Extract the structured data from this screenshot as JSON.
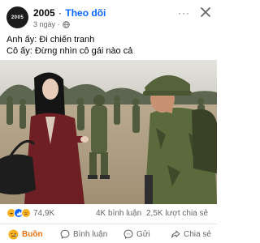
{
  "post": {
    "page_name": "2005",
    "separator": "·",
    "follow_label": "Theo dõi",
    "time_ago": "3 ngày ·",
    "avatar_text": "2005",
    "more_label": "···",
    "caption_line1": "Anh ấy: Đi chiến tranh",
    "caption_line2": "Cô ấy: Đừng nhìn cô gái nào cả"
  },
  "stats": {
    "reaction_count": "74,9K",
    "comments": "4K bình luận",
    "shares": "2,5K lượt chia sẻ"
  },
  "actions": {
    "react_label": "Buồn",
    "comment_label": "Bình luận",
    "send_label": "Gửi",
    "share_label": "Chia sẻ"
  },
  "colors": {
    "follow": "#0866ff",
    "sad_reaction": "#e9710f",
    "muted": "#65676b"
  }
}
